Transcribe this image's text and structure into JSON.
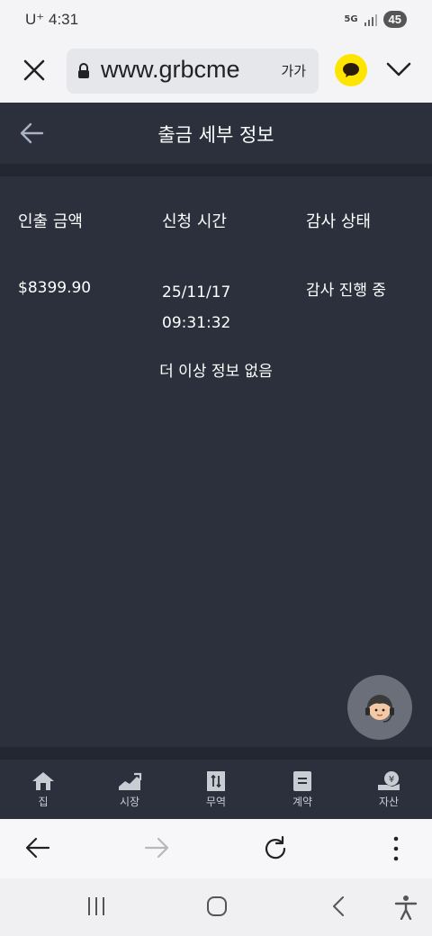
{
  "status_bar": {
    "carrier": "U⁺",
    "time": "4:31",
    "network": "5G",
    "battery": "45"
  },
  "browser": {
    "url": "www.grbcme",
    "text_size_label": "가가"
  },
  "header": {
    "title": "출금 세부 정보"
  },
  "table": {
    "headers": [
      "인출 금액",
      "신청 시간",
      "감사 상태"
    ],
    "row": {
      "amount": "$8399.90",
      "date": "25/11/17",
      "time": "09:31:32",
      "status": "감사 진행 중"
    }
  },
  "empty_message": "더 이상 정보 없음",
  "nav": {
    "items": [
      {
        "label": "집",
        "icon": "home-icon"
      },
      {
        "label": "시장",
        "icon": "market-chart-icon"
      },
      {
        "label": "무역",
        "icon": "trade-icon"
      },
      {
        "label": "계약",
        "icon": "contract-icon"
      },
      {
        "label": "자산",
        "icon": "assets-icon"
      }
    ]
  },
  "colors": {
    "background": "#2b303c",
    "kakao": "#fee500",
    "nav_icon": "#c9ccd3"
  }
}
